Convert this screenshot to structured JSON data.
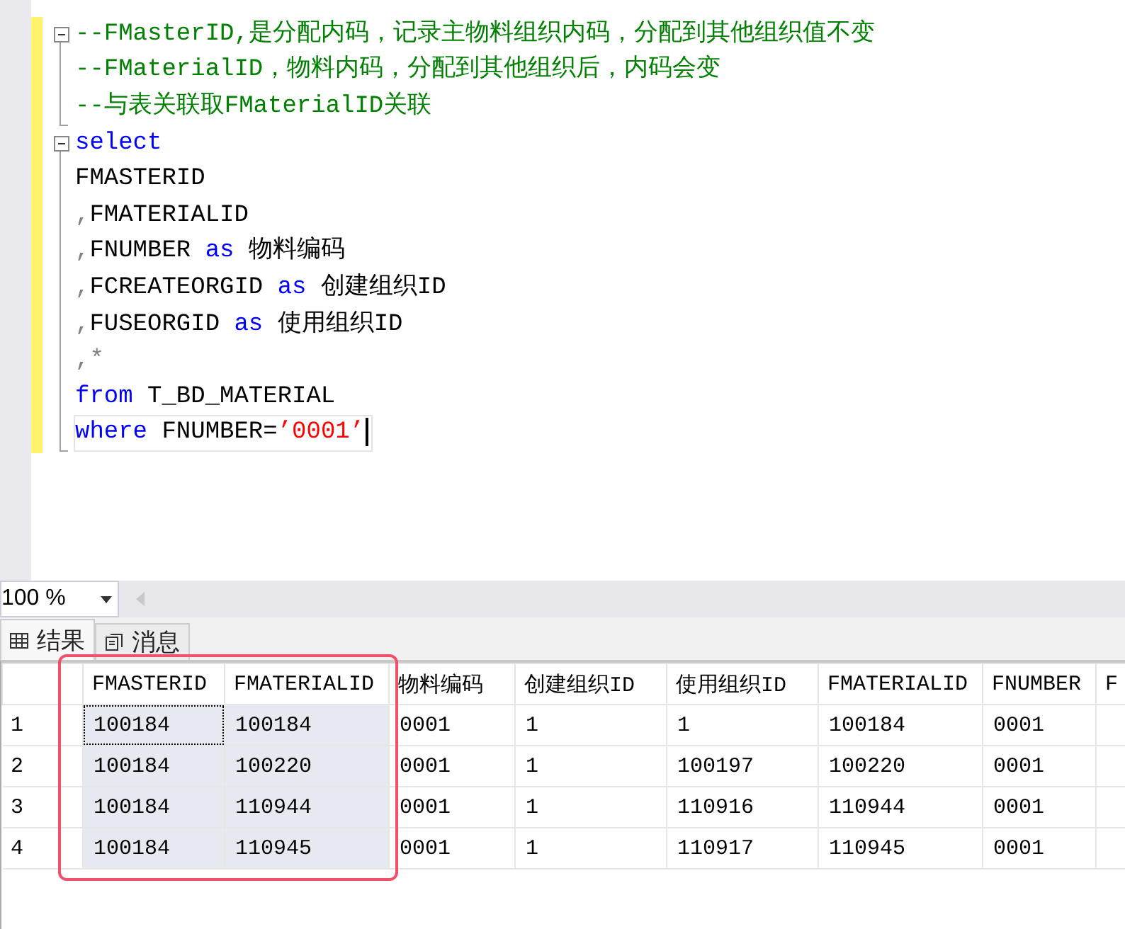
{
  "editor": {
    "lines": [
      {
        "fold_toggle": true,
        "current": false,
        "tokens": [
          {
            "kind": "comment",
            "text": "--FMasterID,是分配内码，记录主物料组织内码，分配到其他组织值不变"
          }
        ]
      },
      {
        "fold_toggle": false,
        "current": false,
        "tokens": [
          {
            "kind": "comment",
            "text": "--FMaterialID，物料内码，分配到其他组织后，内码会变"
          }
        ]
      },
      {
        "fold_toggle": false,
        "current": false,
        "tokens": [
          {
            "kind": "comment",
            "text": "--与表关联取FMaterialID关联"
          }
        ]
      },
      {
        "fold_toggle": true,
        "current": false,
        "tokens": [
          {
            "kind": "keyword",
            "text": "select"
          }
        ]
      },
      {
        "fold_toggle": false,
        "current": false,
        "tokens": [
          {
            "kind": "ident",
            "text": "FMASTERID"
          }
        ]
      },
      {
        "fold_toggle": false,
        "current": false,
        "tokens": [
          {
            "kind": "punct",
            "text": ","
          },
          {
            "kind": "ident",
            "text": "FMATERIALID"
          }
        ]
      },
      {
        "fold_toggle": false,
        "current": false,
        "tokens": [
          {
            "kind": "punct",
            "text": ","
          },
          {
            "kind": "ident",
            "text": "FNUMBER "
          },
          {
            "kind": "keyword",
            "text": "as"
          },
          {
            "kind": "ident",
            "text": " 物料编码"
          }
        ]
      },
      {
        "fold_toggle": false,
        "current": false,
        "tokens": [
          {
            "kind": "punct",
            "text": ","
          },
          {
            "kind": "ident",
            "text": "FCREATEORGID "
          },
          {
            "kind": "keyword",
            "text": "as"
          },
          {
            "kind": "ident",
            "text": " 创建组织ID"
          }
        ]
      },
      {
        "fold_toggle": false,
        "current": false,
        "tokens": [
          {
            "kind": "punct",
            "text": ","
          },
          {
            "kind": "ident",
            "text": "FUSEORGID "
          },
          {
            "kind": "keyword",
            "text": "as"
          },
          {
            "kind": "ident",
            "text": " 使用组织ID"
          }
        ]
      },
      {
        "fold_toggle": false,
        "current": false,
        "tokens": [
          {
            "kind": "punct",
            "text": ",*"
          }
        ]
      },
      {
        "fold_toggle": false,
        "current": false,
        "tokens": [
          {
            "kind": "keyword",
            "text": "from"
          },
          {
            "kind": "ident",
            "text": " T_BD_MATERIAL"
          }
        ]
      },
      {
        "fold_toggle": false,
        "current": true,
        "tokens": [
          {
            "kind": "keyword",
            "text": "where"
          },
          {
            "kind": "ident",
            "text": " FNUMBER="
          },
          {
            "kind": "string",
            "text": "’0001’"
          }
        ]
      }
    ]
  },
  "zoom": {
    "value": "100 %"
  },
  "tabs": [
    {
      "kind": "results",
      "label": "结果",
      "selected": true
    },
    {
      "kind": "messages",
      "label": "消息",
      "selected": false
    }
  ],
  "grid": {
    "columns": [
      "FMASTERID",
      "FMATERIALID",
      "物料编码",
      "创建组织ID",
      "使用组织ID",
      "FMATERIALID",
      "FNUMBER",
      "F"
    ],
    "rows": [
      {
        "number": "1",
        "cells": [
          {
            "text": "100184",
            "selected": true,
            "focused": true
          },
          {
            "text": "100184",
            "selected": true,
            "focused": false
          },
          {
            "text": "0001",
            "selected": false,
            "focused": false
          },
          {
            "text": "1",
            "selected": false,
            "focused": false
          },
          {
            "text": "1",
            "selected": false,
            "focused": false
          },
          {
            "text": "100184",
            "selected": false,
            "focused": false
          },
          {
            "text": "0001",
            "selected": false,
            "focused": false
          }
        ]
      },
      {
        "number": "2",
        "cells": [
          {
            "text": "100184",
            "selected": true,
            "focused": false
          },
          {
            "text": "100220",
            "selected": true,
            "focused": false
          },
          {
            "text": "0001",
            "selected": false,
            "focused": false
          },
          {
            "text": "1",
            "selected": false,
            "focused": false
          },
          {
            "text": "100197",
            "selected": false,
            "focused": false
          },
          {
            "text": "100220",
            "selected": false,
            "focused": false
          },
          {
            "text": "0001",
            "selected": false,
            "focused": false
          }
        ]
      },
      {
        "number": "3",
        "cells": [
          {
            "text": "100184",
            "selected": true,
            "focused": false
          },
          {
            "text": "110944",
            "selected": true,
            "focused": false
          },
          {
            "text": "0001",
            "selected": false,
            "focused": false
          },
          {
            "text": "1",
            "selected": false,
            "focused": false
          },
          {
            "text": "110916",
            "selected": false,
            "focused": false
          },
          {
            "text": "110944",
            "selected": false,
            "focused": false
          },
          {
            "text": "0001",
            "selected": false,
            "focused": false
          }
        ]
      },
      {
        "number": "4",
        "cells": [
          {
            "text": "100184",
            "selected": true,
            "focused": false
          },
          {
            "text": "110945",
            "selected": true,
            "focused": false
          },
          {
            "text": "0001",
            "selected": false,
            "focused": false
          },
          {
            "text": "1",
            "selected": false,
            "focused": false
          },
          {
            "text": "110917",
            "selected": false,
            "focused": false
          },
          {
            "text": "110945",
            "selected": false,
            "focused": false
          },
          {
            "text": "0001",
            "selected": false,
            "focused": false
          }
        ]
      }
    ]
  }
}
